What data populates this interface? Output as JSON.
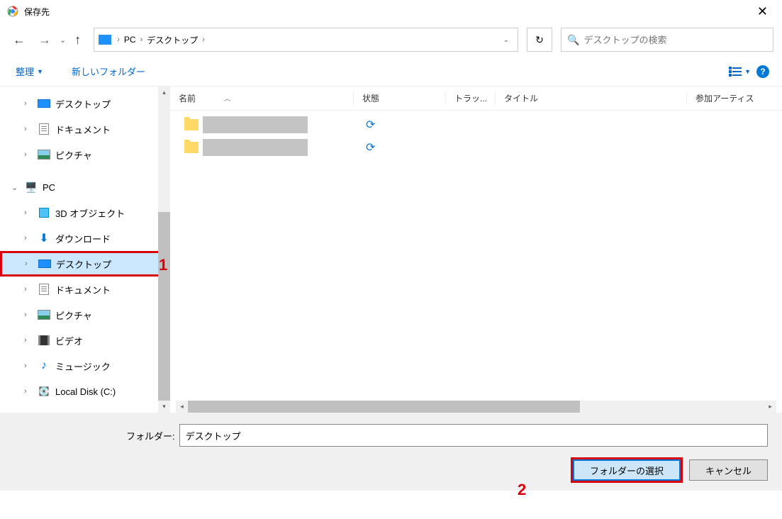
{
  "window": {
    "title": "保存先"
  },
  "address": {
    "crumb1": "PC",
    "crumb2": "デスクトップ"
  },
  "search": {
    "placeholder": "デスクトップの検索"
  },
  "toolbar": {
    "organize": "整理",
    "new_folder": "新しいフォルダー"
  },
  "columns": {
    "name": "名前",
    "status": "状態",
    "track": "トラッ...",
    "title": "タイトル",
    "artist": "参加アーティス"
  },
  "sidebar": {
    "quick": {
      "desktop": "デスクトップ",
      "documents": "ドキュメント",
      "pictures": "ピクチャ"
    },
    "pc": "PC",
    "pc_items": {
      "objects3d": "3D オブジェクト",
      "downloads": "ダウンロード",
      "desktop": "デスクトップ",
      "documents": "ドキュメント",
      "pictures": "ピクチャ",
      "videos": "ビデオ",
      "music": "ミュージック",
      "localdisk": "Local Disk (C:)"
    }
  },
  "footer": {
    "folder_label": "フォルダー:",
    "folder_value": "デスクトップ",
    "select_btn": "フォルダーの選択",
    "cancel_btn": "キャンセル"
  },
  "annotations": {
    "n1": "1",
    "n2": "2"
  }
}
